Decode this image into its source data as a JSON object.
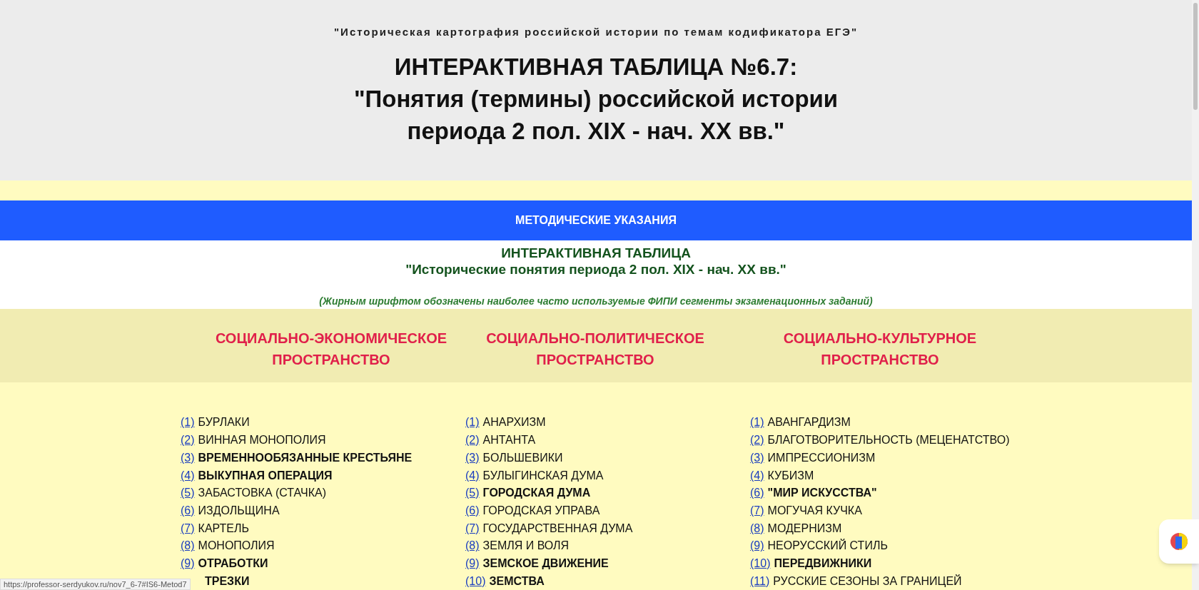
{
  "header": {
    "subtitle": "\"Историческая картография российской истории по темам кодификатора ЕГЭ\"",
    "title_lines": [
      "ИНТЕРАКТИВНАЯ ТАБЛИЦА №6.7:",
      "\"Понятия (термины) российской истории",
      "периода 2 пол. XIX - нач. XX вв.\""
    ]
  },
  "guide_button": "МЕТОДИЧЕСКИЕ УКАЗАНИЯ",
  "intro": {
    "heading_lines": [
      "ИНТЕРАКТИВНАЯ ТАБЛИЦА",
      "\"Исторические понятия периода 2 пол. XIX - нач. XX вв.\""
    ],
    "note": "(Жирным шрифтом обозначены наиболее часто используемые ФИПИ сегменты экзаменационных заданий)"
  },
  "columns": [
    {
      "heading_lines": [
        "СОЦИАЛЬНО-ЭКОНОМИЧЕСКОЕ",
        "ПРОСТРАНСТВО"
      ],
      "items": [
        {
          "number": "(1)",
          "term": "БУРЛАКИ",
          "bold": false
        },
        {
          "number": "(2)",
          "term": "ВИННАЯ МОНОПОЛИЯ",
          "bold": false
        },
        {
          "number": "(3)",
          "term": "ВРЕМЕННООБЯЗАННЫЕ КРЕСТЬЯНЕ",
          "bold": true
        },
        {
          "number": "(4)",
          "term": "ВЫКУПНАЯ ОПЕРАЦИЯ",
          "bold": true
        },
        {
          "number": "(5)",
          "term": "ЗАБАСТОВКА (СТАЧКА)",
          "bold": false
        },
        {
          "number": "(6)",
          "term": "ИЗДОЛЬЩИНА",
          "bold": false
        },
        {
          "number": "(7)",
          "term": "КАРТЕЛЬ",
          "bold": false
        },
        {
          "number": "(8)",
          "term": "МОНОПОЛИЯ",
          "bold": false
        },
        {
          "number": "(9)",
          "term": "ОТРАБОТКИ",
          "bold": true
        },
        {
          "term": "ТРЕЗКИ",
          "bold": true
        }
      ]
    },
    {
      "heading_lines": [
        "СОЦИАЛЬНО-ПОЛИТИЧЕСКОЕ",
        "ПРОСТРАНСТВО"
      ],
      "items": [
        {
          "number": "(1)",
          "term": "АНАРХИЗМ",
          "bold": false
        },
        {
          "number": "(2)",
          "term": "АНТАНТА",
          "bold": false
        },
        {
          "number": "(3)",
          "term": "БОЛЬШЕВИКИ",
          "bold": false
        },
        {
          "number": "(4)",
          "term": "БУЛЫГИНСКАЯ ДУМА",
          "bold": false
        },
        {
          "number": "(5)",
          "term": "ГОРОДСКАЯ ДУМА",
          "bold": true
        },
        {
          "number": "(6)",
          "term": "ГОРОДСКАЯ УПРАВА",
          "bold": false
        },
        {
          "number": "(7)",
          "term": "ГОСУДАРСТВЕННАЯ ДУМА",
          "bold": false
        },
        {
          "number": "(8)",
          "term": "ЗЕМЛЯ И ВОЛЯ",
          "bold": false
        },
        {
          "number": "(9)",
          "term": "ЗЕМСКОЕ ДВИЖЕНИЕ",
          "bold": true
        },
        {
          "number": "(10)",
          "term": "ЗЕМСТВА",
          "bold": true
        }
      ]
    },
    {
      "heading_lines": [
        "СОЦИАЛЬНО-КУЛЬТУРНОЕ",
        "ПРОСТРАНСТВО"
      ],
      "items": [
        {
          "number": "(1)",
          "term": "АВАНГАРДИЗМ",
          "bold": false
        },
        {
          "number": "(2)",
          "term": "БЛАГОТВОРИТЕЛЬНОСТЬ (МЕЦЕНАТСТВО)",
          "bold": false
        },
        {
          "number": "(3)",
          "term": "ИМПРЕССИОНИЗМ",
          "bold": false
        },
        {
          "number": "(4)",
          "term": "КУБИЗМ",
          "bold": false
        },
        {
          "number": "(6)",
          "term": "\"МИР ИСКУССТВА\"",
          "bold": true
        },
        {
          "number": "(7)",
          "term": "МОГУЧАЯ КУЧКА",
          "bold": false
        },
        {
          "number": "(8)",
          "term": "МОДЕРНИЗМ",
          "bold": false
        },
        {
          "number": "(9)",
          "term": "НЕОРУССКИЙ СТИЛЬ",
          "bold": false
        },
        {
          "number": "(10)",
          "term": "ПЕРЕДВИЖНИКИ",
          "bold": true
        },
        {
          "number": "(11)",
          "term": "РУССКИЕ СЕЗОНЫ ЗА ГРАНИЦЕЙ",
          "bold": false
        }
      ]
    }
  ],
  "status_bar": "https://professor-serdyukov.ru/nov7_6-7#IS6-Metod7"
}
